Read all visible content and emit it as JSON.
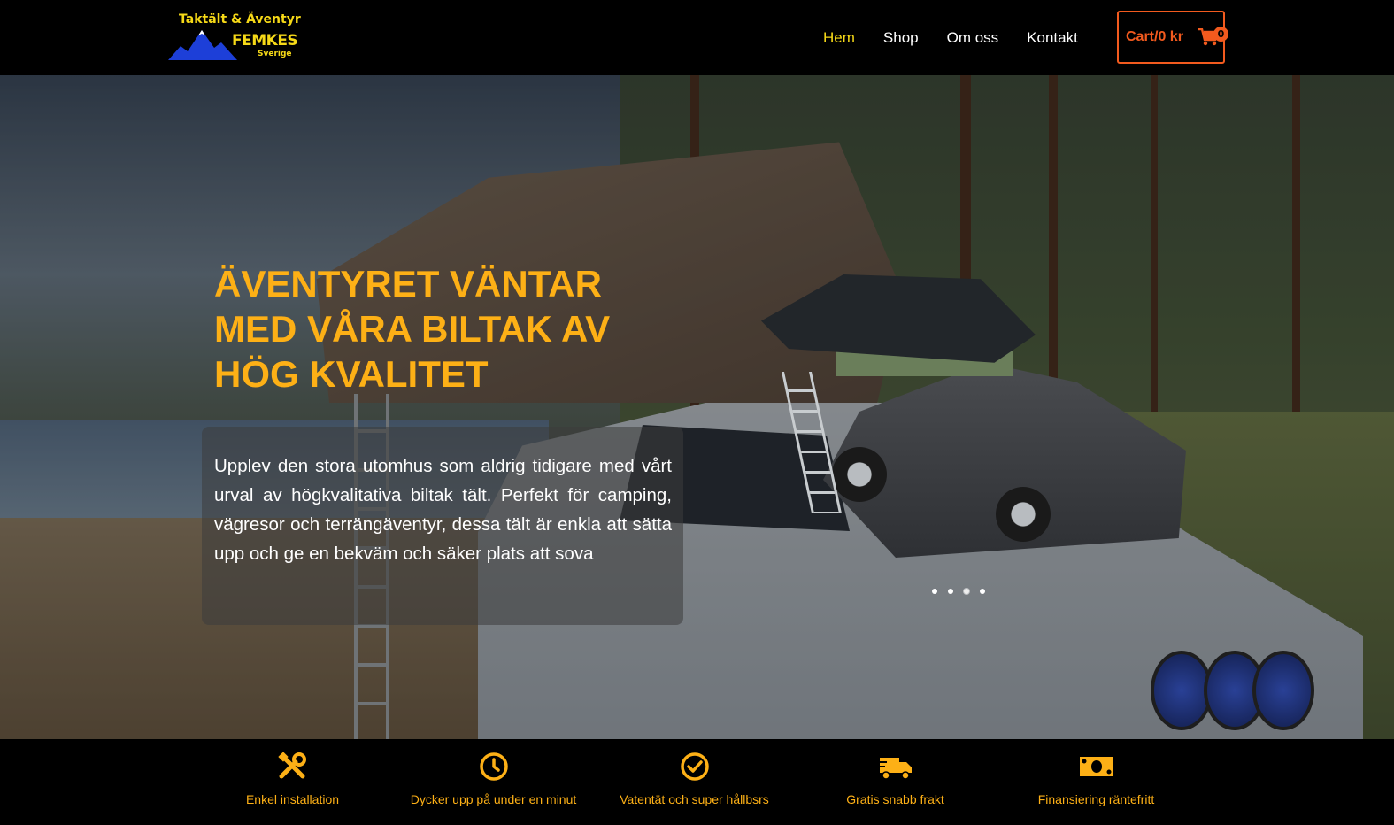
{
  "header": {
    "logo": {
      "tagline": "Taktält & Äventyr",
      "brand": "FEMKES",
      "sub": "Sverige"
    },
    "nav": [
      {
        "label": "Hem",
        "active": true
      },
      {
        "label": "Shop",
        "active": false
      },
      {
        "label": "Om oss",
        "active": false
      },
      {
        "label": "Kontakt",
        "active": false
      }
    ],
    "cart": {
      "label": "Cart/0 kr",
      "count": "0",
      "icon": "cart-icon"
    }
  },
  "hero": {
    "title": "ÄVENTYRET VÄNTAR MED VÅRA BILTAK AV HÖG KVALITET",
    "text": "Upplev den stora utomhus som aldrig tidigare med vårt urval av högkvalitativa biltak tält. Perfekt för camping, vägresor och terrängäventyr, dessa tält är enkla att sätta upp och ge en bekväm och säker plats att sova",
    "slides": 4,
    "active_slide": 3
  },
  "features": [
    {
      "label": "Enkel installation",
      "icon": "tools-icon"
    },
    {
      "label": "Dycker upp på under en minut",
      "icon": "clock-icon"
    },
    {
      "label": "Vatentät och super hållbsrs",
      "icon": "check-circle-icon"
    },
    {
      "label": "Gratis snabb frakt",
      "icon": "truck-icon"
    },
    {
      "label": "Finansiering räntefritt",
      "icon": "money-icon"
    }
  ],
  "colors": {
    "accent": "#fdb016",
    "nav_active": "#f6d917",
    "cart": "#f25a1e",
    "background": "#000000"
  }
}
